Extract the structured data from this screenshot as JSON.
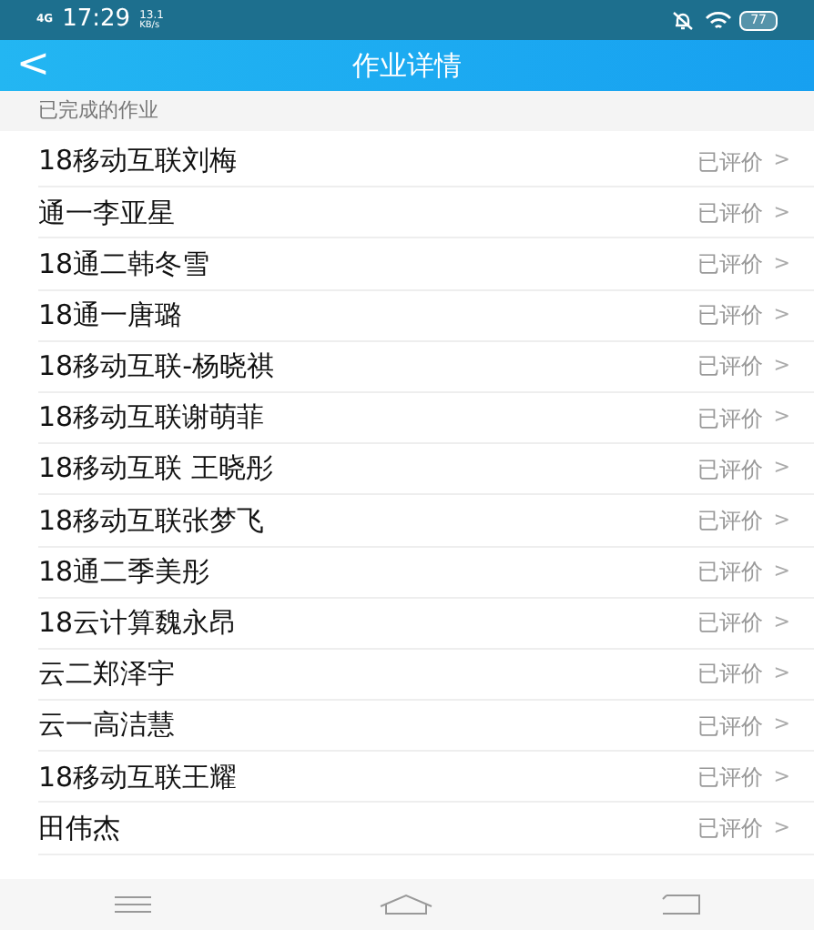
{
  "status_bar": {
    "network": "4G",
    "time": "17:29",
    "speed_value": "13.1",
    "speed_unit": "KB/s",
    "battery": "77"
  },
  "header": {
    "back": "<",
    "title": "作业详情"
  },
  "section_label": "已完成的作业",
  "rows": [
    {
      "name": "18移动互联刘梅",
      "status": "已评价",
      "arrow": ">"
    },
    {
      "name": "通一李亚星",
      "status": "已评价",
      "arrow": ">"
    },
    {
      "name": "18通二韩冬雪",
      "status": "已评价",
      "arrow": ">"
    },
    {
      "name": "18通一唐璐",
      "status": "已评价",
      "arrow": ">"
    },
    {
      "name": "18移动互联-杨晓祺",
      "status": "已评价",
      "arrow": ">"
    },
    {
      "name": "18移动互联谢萌菲",
      "status": "已评价",
      "arrow": ">"
    },
    {
      "name": "18移动互联 王晓彤",
      "status": "已评价",
      "arrow": ">"
    },
    {
      "name": "18移动互联张梦飞",
      "status": "已评价",
      "arrow": ">"
    },
    {
      "name": "18通二季美彤",
      "status": "已评价",
      "arrow": ">"
    },
    {
      "name": "18云计算魏永昂",
      "status": "已评价",
      "arrow": ">"
    },
    {
      "name": "云二郑泽宇",
      "status": "已评价",
      "arrow": ">"
    },
    {
      "name": "云一高洁慧",
      "status": "已评价",
      "arrow": ">"
    },
    {
      "name": "18移动互联王耀",
      "status": "已评价",
      "arrow": ">"
    },
    {
      "name": "田伟杰",
      "status": "已评价",
      "arrow": ">"
    }
  ]
}
